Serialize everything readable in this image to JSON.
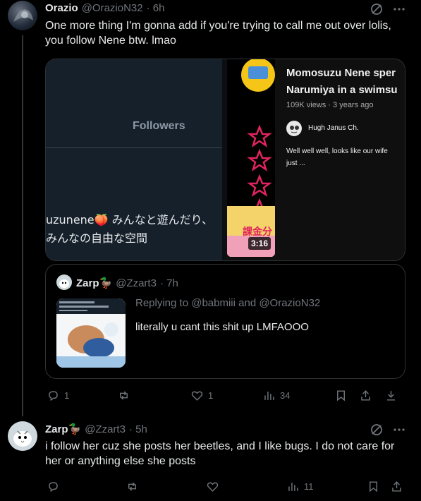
{
  "tweet1": {
    "name": "Orazio",
    "handle": "@OrazioN32",
    "time": "· 6h",
    "text": "One more thing I'm gonna add if you're trying to call me out over lolis, you follow Nene btw. lmao",
    "media_left": {
      "followers_label": "Followers",
      "jp_line1": "uzunene🍑 みんなと遊んだり、",
      "jp_line2": "みんなの自由な空間"
    },
    "media_right": {
      "video_title_line1": "Momosuzu Nene sper",
      "video_title_line2": "Narumiya in a swimsu",
      "views": "109K views · 3 years ago",
      "channel": "Hugh Janus Ch.",
      "comment_line1": "Well well well, looks like our wife",
      "comment_line2": "just ...",
      "badge_text": "課金分",
      "duration": "3:16"
    },
    "quote": {
      "name": "Zarp🦆",
      "handle": "@Zzart3",
      "time": "· 7h",
      "replying_prefix": "Replying to ",
      "replying_to": "@babmiii and @OrazioN32",
      "text": "literally u cant this shit up LMFAOOO"
    },
    "actions": {
      "replies": "1",
      "retweets": "",
      "likes": "1",
      "views": "34"
    }
  },
  "tweet2": {
    "name": "Zarp🦆",
    "handle": "@Zzart3",
    "time": "· 5h",
    "text": "i follow her cuz she posts her beetles, and I like bugs. I do not care for her or anything else she posts",
    "actions": {
      "replies": "",
      "retweets": "",
      "likes": "",
      "views": "11"
    }
  },
  "colors": {
    "background": "#000000",
    "text": "#e7e9ea",
    "muted": "#71767b",
    "border": "#2f3336"
  }
}
